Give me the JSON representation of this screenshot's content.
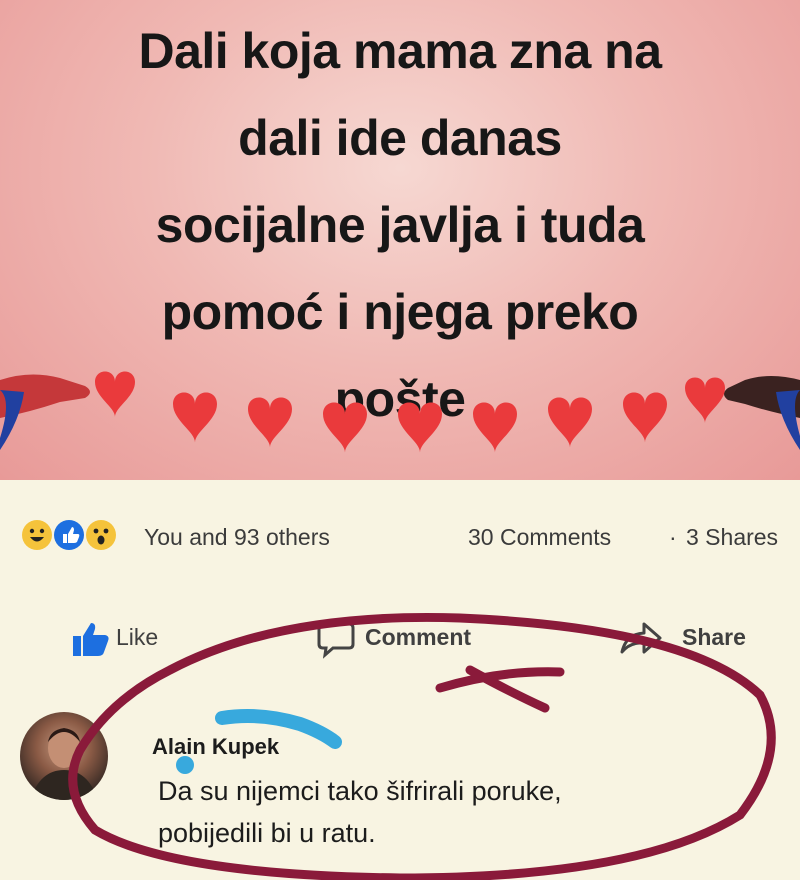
{
  "post": {
    "text_lines": [
      "Dali koja mama zna na",
      "dali ide danas",
      "socijalne javlja i tuda",
      "pomoć i njega preko",
      "pošte"
    ]
  },
  "reactions": {
    "summary": "You and 93 others",
    "comments": "30 Comments",
    "separator": "·",
    "shares": "3 Shares"
  },
  "actions": {
    "like": "Like",
    "comment": "Comment",
    "share": "Share"
  },
  "comment": {
    "author": "Alain Kupek",
    "text_lines": [
      "Da su nijemci tako šifrirali poruke,",
      "pobijedili bi u ratu."
    ]
  },
  "colors": {
    "like_blue": "#1d6fe0",
    "marker_red": "#8a1a3a",
    "redact_blue": "#38a9dd",
    "heart_red": "#ea3a3c"
  }
}
